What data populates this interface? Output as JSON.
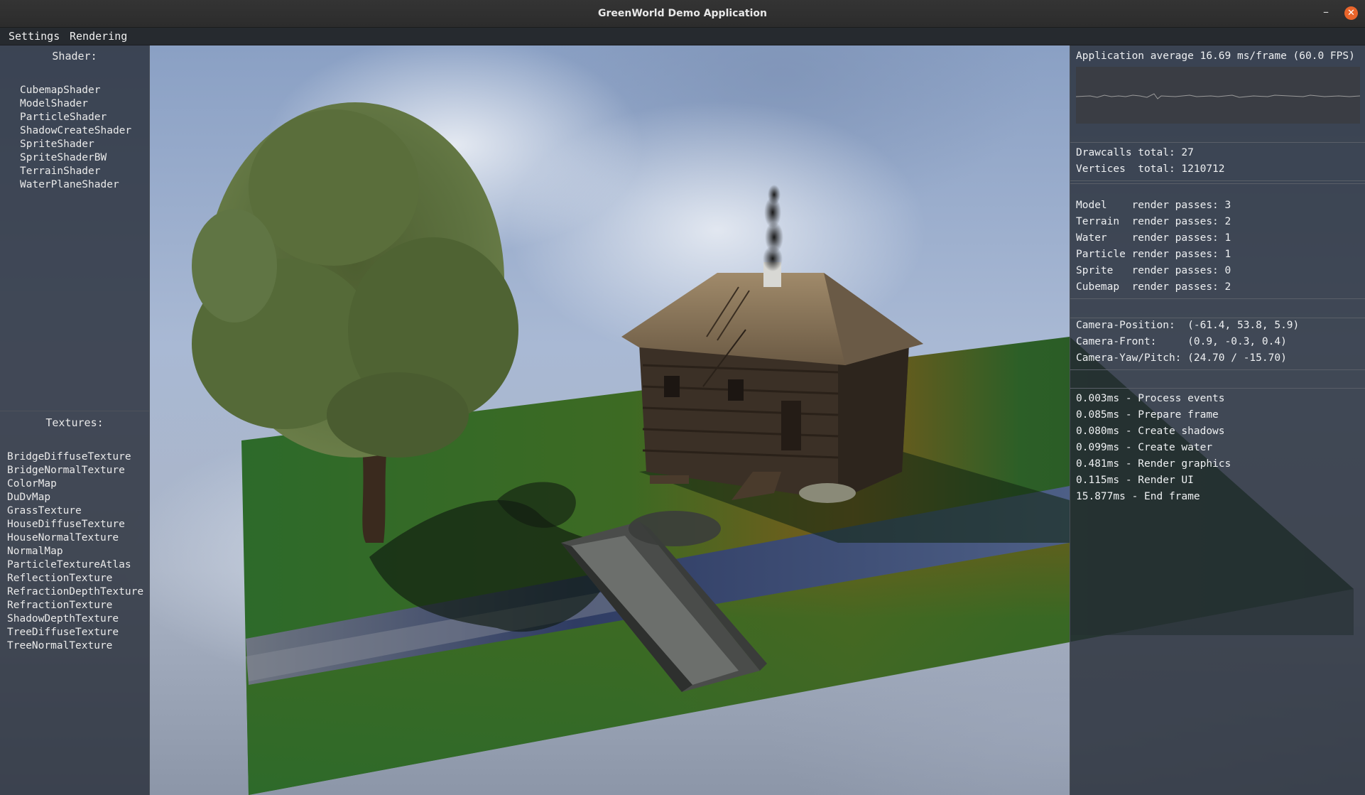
{
  "window": {
    "title": "GreenWorld Demo Application",
    "minimize_glyph": "–",
    "close_glyph": "✕"
  },
  "menubar": {
    "items": [
      "Settings",
      "Rendering"
    ]
  },
  "shader_panel": {
    "heading": "Shader:",
    "items": [
      "CubemapShader",
      "ModelShader",
      "ParticleShader",
      "ShadowCreateShader",
      "SpriteShader",
      "SpriteShaderBW",
      "TerrainShader",
      "WaterPlaneShader"
    ]
  },
  "texture_panel": {
    "heading": "Textures:",
    "items": [
      "BridgeDiffuseTexture",
      "BridgeNormalTexture",
      "ColorMap",
      "DuDvMap",
      "GrassTexture",
      "HouseDiffuseTexture",
      "HouseNormalTexture",
      "NormalMap",
      "ParticleTextureAtlas",
      "ReflectionTexture",
      "RefractionDepthTexture",
      "RefractionTexture",
      "ShadowDepthTexture",
      "TreeDiffuseTexture",
      "TreeNormalTexture"
    ]
  },
  "stats_panel": {
    "fps_line": "Application average 16.69 ms/frame (60.0 FPS)",
    "drawcalls": "Drawcalls total: 27",
    "vertices": "Vertices  total: 1210712",
    "render_passes": [
      "Model    render passes: 3",
      "Terrain  render passes: 2",
      "Water    render passes: 1",
      "Particle render passes: 1",
      "Sprite   render passes: 0",
      "Cubemap  render passes: 2"
    ],
    "camera": [
      "Camera-Position:  (-61.4, 53.8, 5.9)",
      "Camera-Front:     (0.9, -0.3, 0.4)",
      "Camera-Yaw/Pitch: (24.70 / -15.70)"
    ],
    "timings": [
      "0.003ms - Process events",
      "0.085ms - Prepare frame",
      "0.080ms - Create shadows",
      "0.099ms - Create water",
      "0.481ms - Render graphics",
      "0.115ms - Render UI",
      "15.877ms - End frame"
    ]
  },
  "colors": {
    "close_button": "#e9652b",
    "panel_bg": "#2a303a",
    "grass": "#2f6a2a",
    "water": "#33446a"
  }
}
